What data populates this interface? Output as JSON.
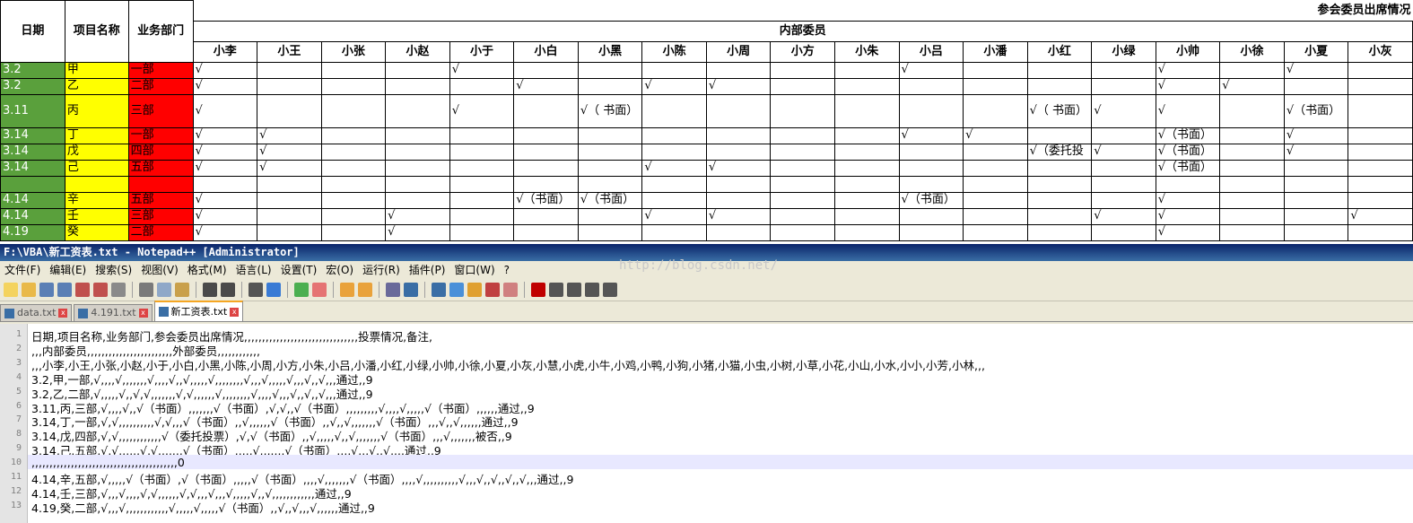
{
  "sheet": {
    "title": "参会委员出席情况",
    "subtitle": "内部委员",
    "headers": {
      "date": "日期",
      "project": "项目名称",
      "dept": "业务部门"
    },
    "members": [
      "小李",
      "小王",
      "小张",
      "小赵",
      "小于",
      "小白",
      "小黑",
      "小陈",
      "小周",
      "小方",
      "小朱",
      "小吕",
      "小潘",
      "小红",
      "小绿",
      "小帅",
      "小徐",
      "小夏",
      "小灰"
    ],
    "rows": [
      {
        "date": "3.2",
        "project": "甲",
        "dept": "一部",
        "cells": [
          "√",
          "",
          "",
          "",
          "√",
          "",
          "",
          "",
          "",
          "",
          "",
          "√",
          "",
          "",
          "",
          "√",
          "",
          "√",
          ""
        ]
      },
      {
        "date": "3.2",
        "project": "乙",
        "dept": "二部",
        "cells": [
          "√",
          "",
          "",
          "",
          "",
          "√",
          "",
          "√",
          "√",
          "",
          "",
          "",
          "",
          "",
          "",
          "√",
          "√",
          "",
          ""
        ]
      },
      {
        "date": "3.11",
        "project": "丙",
        "dept": "三部",
        "cells": [
          "√",
          "",
          "",
          "",
          "√",
          "",
          "√（ 书面）",
          "",
          "",
          "",
          "",
          "",
          "",
          "√（ 书面）",
          "√",
          "√",
          "",
          "√（书面）",
          ""
        ]
      },
      {
        "date": "3.14",
        "project": "丁",
        "dept": "一部",
        "cells": [
          "√",
          "√",
          "",
          "",
          "",
          "",
          "",
          "",
          "",
          "",
          "",
          "√",
          "√",
          "",
          "",
          "√（书面）",
          "",
          "√",
          ""
        ]
      },
      {
        "date": "3.14",
        "project": "戊",
        "dept": "四部",
        "cells": [
          "√",
          "√",
          "",
          "",
          "",
          "",
          "",
          "",
          "",
          "",
          "",
          "",
          "",
          "√（委托投",
          "√",
          "√（书面）",
          "",
          "√",
          ""
        ]
      },
      {
        "date": "3.14",
        "project": "己",
        "dept": "五部",
        "cells": [
          "√",
          "√",
          "",
          "",
          "",
          "",
          "",
          "√",
          "√",
          "",
          "",
          "",
          "",
          "",
          "",
          "√（书面）",
          "",
          "",
          ""
        ]
      },
      {
        "date": "",
        "project": "",
        "dept": "",
        "cells": [
          "",
          "",
          "",
          "",
          "",
          "",
          "",
          "",
          "",
          "",
          "",
          "",
          "",
          "",
          "",
          "",
          "",
          "",
          ""
        ]
      },
      {
        "date": "4.14",
        "project": "辛",
        "dept": "五部",
        "cells": [
          "√",
          "",
          "",
          "",
          "",
          "√（书面）",
          "√（书面）",
          "",
          "",
          "",
          "",
          "√（书面）",
          "",
          "",
          "",
          "√",
          "",
          "",
          ""
        ]
      },
      {
        "date": "4.14",
        "project": "壬",
        "dept": "三部",
        "cells": [
          "√",
          "",
          "",
          "√",
          "",
          "",
          "",
          "√",
          "√",
          "",
          "",
          "",
          "",
          "",
          "√",
          "√",
          "",
          "",
          "√"
        ]
      },
      {
        "date": "4.19",
        "project": "癸",
        "dept": "二部",
        "cells": [
          "√",
          "",
          "",
          "√",
          "",
          "",
          "",
          "",
          "",
          "",
          "",
          "",
          "",
          "",
          "",
          "√",
          "",
          "",
          ""
        ]
      }
    ]
  },
  "npp": {
    "title": "F:\\VBA\\新工资表.txt - Notepad++ [Administrator]",
    "watermark": "http://blog.csdn.net/",
    "menu": [
      "文件(F)",
      "编辑(E)",
      "搜索(S)",
      "视图(V)",
      "格式(M)",
      "语言(L)",
      "设置(T)",
      "宏(O)",
      "运行(R)",
      "插件(P)",
      "窗口(W)",
      "?"
    ],
    "tabs": [
      "data.txt",
      "4.191.txt",
      "新工资表.txt"
    ],
    "lines": [
      "日期,项目名称,业务部门,参会委员出席情况,,,,,,,,,,,,,,,,,,,,,,,,,,,,,,,,投票情况,备注,",
      ",,,内部委员,,,,,,,,,,,,,,,,,,,,,,,,外部委员,,,,,,,,,,,,",
      ",,,小李,小王,小张,小赵,小于,小白,小黑,小陈,小周,小方,小朱,小吕,小潘,小红,小绿,小帅,小徐,小夏,小灰,小慧,小虎,小牛,小鸡,小鸭,小狗,小猪,小猫,小虫,小树,小草,小花,小山,小水,小小,小芳,小林,,,",
      "3.2,甲,一部,√,,,,√,,,,,,,√,,,,√,,√,,,,,√,,,,,,,,√,,,√,,,,,√,,,√,,√,,,通过,,9",
      "3.2,乙,二部,√,,,,,√,,√,√,,,,,,,√,√,,,,,,√,,,,,,,,√,,,,√,,,√,,√,,√,,,通过,,9",
      "3.11,丙,三部,√,,,,√,,√（书面）,,,,,,,√（书面）,√,√,,√（书面）,,,,,,,,,√,,,,√,,,,,√（书面）,,,,,,通过,,9",
      "3.14,丁,一部,√,√,,,,,,,,,,√,√,,,√（书面）,,√,,,,,,√（书面）,,√,,√,,,,,,,√（书面）,,,√,,√,,,,,,通过,,9",
      "3.14,戊,四部,√,√,,,,,,,,,,,,√（委托投票）,√,√（书面）,,√,,,,,√,,√,,,,,,,√（书面）,,,√,,,,,,,被否,,9",
      "3.14,己,五部,√,√,,,,,,√,√,,,,,,,√（书面）,,,,,√,,,,,,,√（书面）,,,,√,,,√,,√,,,,通过,,9",
      ",,,,,,,,,,,,,,,,,,,,,,,,,,,,,,,,,,,,,,,,,0",
      "4.14,辛,五部,√,,,,,√（书面）,√（书面）,,,,,√（书面）,,,,√,,,,,,,√（书面）,,,,√,,,,,,,,,,√,,,√,,√,,√,,√,,,通过,,9",
      "4.14,壬,三部,√,,,√,,,,√,√,,,,,,√,√,,,√,,,√,,,,,√,,√,,,,,,,,,,,,通过,,9",
      "4.19,癸,二部,√,,,√,,,,,,,,,,,,√,,,,,√,,,,,√（书面）,,√,,√,,,√,,,,,,通过,,9"
    ]
  }
}
